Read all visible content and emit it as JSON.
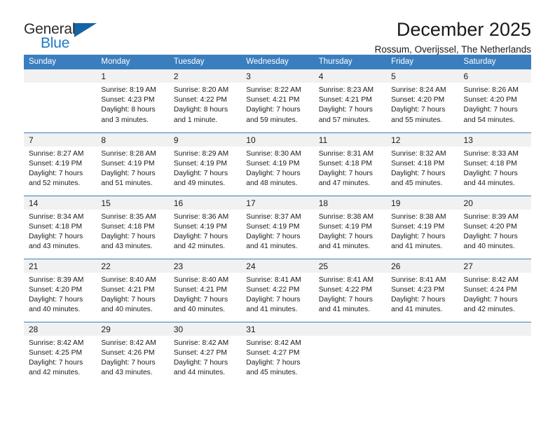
{
  "brand": {
    "word1": "General",
    "word2": "Blue",
    "triangle_color": "#1464a5",
    "blue_text_color": "#1d7ac4"
  },
  "header": {
    "month_title": "December 2025",
    "location": "Rossum, Overijssel, The Netherlands",
    "header_bg": "#3a7ebf",
    "daynum_bg": "#f1f1f1"
  },
  "weekdays": [
    "Sunday",
    "Monday",
    "Tuesday",
    "Wednesday",
    "Thursday",
    "Friday",
    "Saturday"
  ],
  "weeks": [
    [
      {
        "day": "",
        "sunrise": "",
        "sunset": "",
        "daylight1": "",
        "daylight2": ""
      },
      {
        "day": "1",
        "sunrise": "Sunrise: 8:19 AM",
        "sunset": "Sunset: 4:23 PM",
        "daylight1": "Daylight: 8 hours",
        "daylight2": "and 3 minutes."
      },
      {
        "day": "2",
        "sunrise": "Sunrise: 8:20 AM",
        "sunset": "Sunset: 4:22 PM",
        "daylight1": "Daylight: 8 hours",
        "daylight2": "and 1 minute."
      },
      {
        "day": "3",
        "sunrise": "Sunrise: 8:22 AM",
        "sunset": "Sunset: 4:21 PM",
        "daylight1": "Daylight: 7 hours",
        "daylight2": "and 59 minutes."
      },
      {
        "day": "4",
        "sunrise": "Sunrise: 8:23 AM",
        "sunset": "Sunset: 4:21 PM",
        "daylight1": "Daylight: 7 hours",
        "daylight2": "and 57 minutes."
      },
      {
        "day": "5",
        "sunrise": "Sunrise: 8:24 AM",
        "sunset": "Sunset: 4:20 PM",
        "daylight1": "Daylight: 7 hours",
        "daylight2": "and 55 minutes."
      },
      {
        "day": "6",
        "sunrise": "Sunrise: 8:26 AM",
        "sunset": "Sunset: 4:20 PM",
        "daylight1": "Daylight: 7 hours",
        "daylight2": "and 54 minutes."
      }
    ],
    [
      {
        "day": "7",
        "sunrise": "Sunrise: 8:27 AM",
        "sunset": "Sunset: 4:19 PM",
        "daylight1": "Daylight: 7 hours",
        "daylight2": "and 52 minutes."
      },
      {
        "day": "8",
        "sunrise": "Sunrise: 8:28 AM",
        "sunset": "Sunset: 4:19 PM",
        "daylight1": "Daylight: 7 hours",
        "daylight2": "and 51 minutes."
      },
      {
        "day": "9",
        "sunrise": "Sunrise: 8:29 AM",
        "sunset": "Sunset: 4:19 PM",
        "daylight1": "Daylight: 7 hours",
        "daylight2": "and 49 minutes."
      },
      {
        "day": "10",
        "sunrise": "Sunrise: 8:30 AM",
        "sunset": "Sunset: 4:19 PM",
        "daylight1": "Daylight: 7 hours",
        "daylight2": "and 48 minutes."
      },
      {
        "day": "11",
        "sunrise": "Sunrise: 8:31 AM",
        "sunset": "Sunset: 4:18 PM",
        "daylight1": "Daylight: 7 hours",
        "daylight2": "and 47 minutes."
      },
      {
        "day": "12",
        "sunrise": "Sunrise: 8:32 AM",
        "sunset": "Sunset: 4:18 PM",
        "daylight1": "Daylight: 7 hours",
        "daylight2": "and 45 minutes."
      },
      {
        "day": "13",
        "sunrise": "Sunrise: 8:33 AM",
        "sunset": "Sunset: 4:18 PM",
        "daylight1": "Daylight: 7 hours",
        "daylight2": "and 44 minutes."
      }
    ],
    [
      {
        "day": "14",
        "sunrise": "Sunrise: 8:34 AM",
        "sunset": "Sunset: 4:18 PM",
        "daylight1": "Daylight: 7 hours",
        "daylight2": "and 43 minutes."
      },
      {
        "day": "15",
        "sunrise": "Sunrise: 8:35 AM",
        "sunset": "Sunset: 4:18 PM",
        "daylight1": "Daylight: 7 hours",
        "daylight2": "and 43 minutes."
      },
      {
        "day": "16",
        "sunrise": "Sunrise: 8:36 AM",
        "sunset": "Sunset: 4:19 PM",
        "daylight1": "Daylight: 7 hours",
        "daylight2": "and 42 minutes."
      },
      {
        "day": "17",
        "sunrise": "Sunrise: 8:37 AM",
        "sunset": "Sunset: 4:19 PM",
        "daylight1": "Daylight: 7 hours",
        "daylight2": "and 41 minutes."
      },
      {
        "day": "18",
        "sunrise": "Sunrise: 8:38 AM",
        "sunset": "Sunset: 4:19 PM",
        "daylight1": "Daylight: 7 hours",
        "daylight2": "and 41 minutes."
      },
      {
        "day": "19",
        "sunrise": "Sunrise: 8:38 AM",
        "sunset": "Sunset: 4:19 PM",
        "daylight1": "Daylight: 7 hours",
        "daylight2": "and 41 minutes."
      },
      {
        "day": "20",
        "sunrise": "Sunrise: 8:39 AM",
        "sunset": "Sunset: 4:20 PM",
        "daylight1": "Daylight: 7 hours",
        "daylight2": "and 40 minutes."
      }
    ],
    [
      {
        "day": "21",
        "sunrise": "Sunrise: 8:39 AM",
        "sunset": "Sunset: 4:20 PM",
        "daylight1": "Daylight: 7 hours",
        "daylight2": "and 40 minutes."
      },
      {
        "day": "22",
        "sunrise": "Sunrise: 8:40 AM",
        "sunset": "Sunset: 4:21 PM",
        "daylight1": "Daylight: 7 hours",
        "daylight2": "and 40 minutes."
      },
      {
        "day": "23",
        "sunrise": "Sunrise: 8:40 AM",
        "sunset": "Sunset: 4:21 PM",
        "daylight1": "Daylight: 7 hours",
        "daylight2": "and 40 minutes."
      },
      {
        "day": "24",
        "sunrise": "Sunrise: 8:41 AM",
        "sunset": "Sunset: 4:22 PM",
        "daylight1": "Daylight: 7 hours",
        "daylight2": "and 41 minutes."
      },
      {
        "day": "25",
        "sunrise": "Sunrise: 8:41 AM",
        "sunset": "Sunset: 4:22 PM",
        "daylight1": "Daylight: 7 hours",
        "daylight2": "and 41 minutes."
      },
      {
        "day": "26",
        "sunrise": "Sunrise: 8:41 AM",
        "sunset": "Sunset: 4:23 PM",
        "daylight1": "Daylight: 7 hours",
        "daylight2": "and 41 minutes."
      },
      {
        "day": "27",
        "sunrise": "Sunrise: 8:42 AM",
        "sunset": "Sunset: 4:24 PM",
        "daylight1": "Daylight: 7 hours",
        "daylight2": "and 42 minutes."
      }
    ],
    [
      {
        "day": "28",
        "sunrise": "Sunrise: 8:42 AM",
        "sunset": "Sunset: 4:25 PM",
        "daylight1": "Daylight: 7 hours",
        "daylight2": "and 42 minutes."
      },
      {
        "day": "29",
        "sunrise": "Sunrise: 8:42 AM",
        "sunset": "Sunset: 4:26 PM",
        "daylight1": "Daylight: 7 hours",
        "daylight2": "and 43 minutes."
      },
      {
        "day": "30",
        "sunrise": "Sunrise: 8:42 AM",
        "sunset": "Sunset: 4:27 PM",
        "daylight1": "Daylight: 7 hours",
        "daylight2": "and 44 minutes."
      },
      {
        "day": "31",
        "sunrise": "Sunrise: 8:42 AM",
        "sunset": "Sunset: 4:27 PM",
        "daylight1": "Daylight: 7 hours",
        "daylight2": "and 45 minutes."
      },
      {
        "day": "",
        "sunrise": "",
        "sunset": "",
        "daylight1": "",
        "daylight2": ""
      },
      {
        "day": "",
        "sunrise": "",
        "sunset": "",
        "daylight1": "",
        "daylight2": ""
      },
      {
        "day": "",
        "sunrise": "",
        "sunset": "",
        "daylight1": "",
        "daylight2": ""
      }
    ]
  ]
}
